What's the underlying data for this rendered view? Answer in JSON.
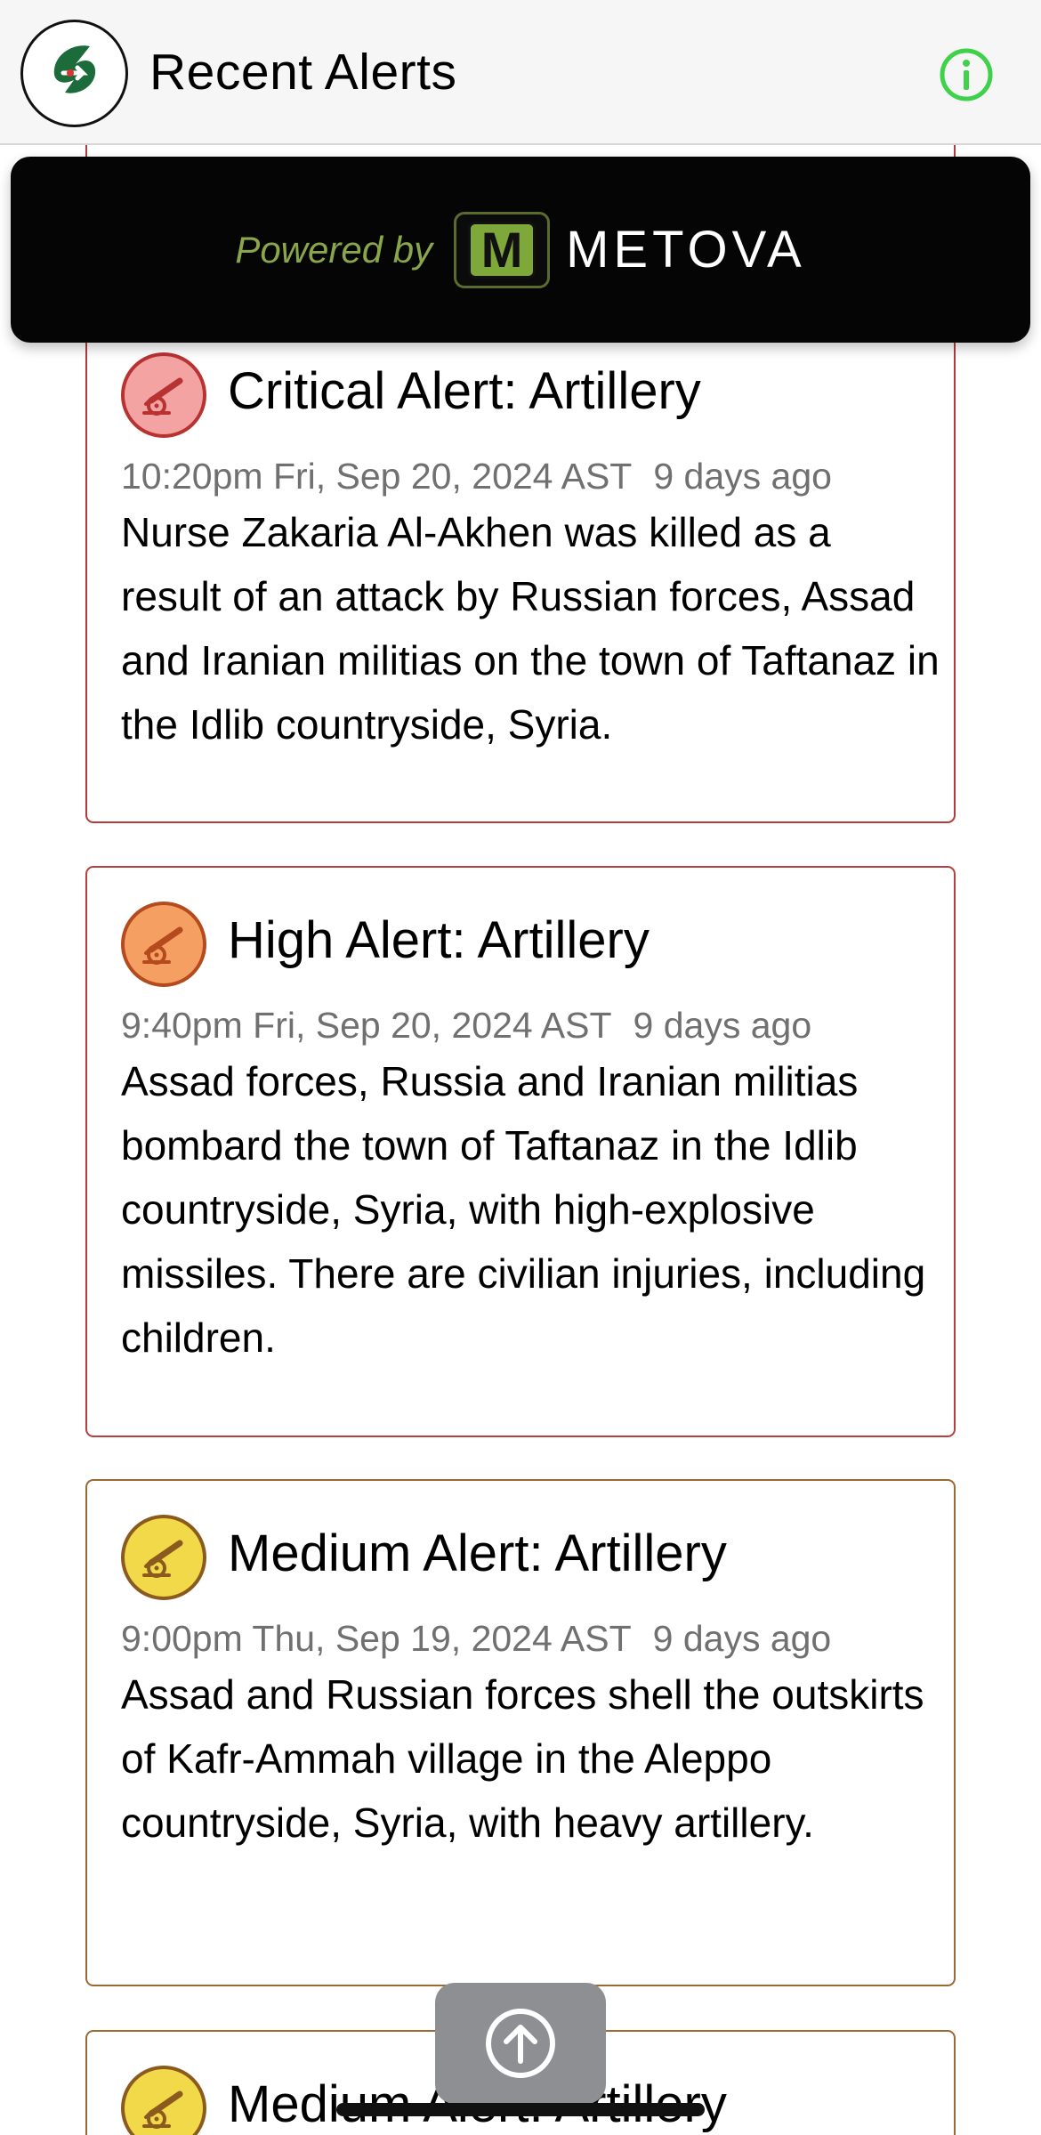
{
  "header": {
    "title": "Recent Alerts",
    "logo_icon": "app-logo-icon",
    "info_icon": "info-icon",
    "info_color": "#3fd14a"
  },
  "banner": {
    "powered_by": "Powered by",
    "brand_letter": "M",
    "brand_name": "METOVA"
  },
  "alerts": [
    {
      "title": "Critical Alert: Artillery",
      "time": "10:20pm Fri, Sep 20, 2024 AST",
      "ago": "9 days ago",
      "body": "Nurse Zakaria Al-Akhen was killed as a result of an attack by Russian forces, Assad and Iranian militias on the town of Taftanaz in the Idlib countryside, Syria.",
      "severity": "critical",
      "icon": "artillery-icon",
      "border_color": "#b23a3a",
      "icon_fill": "#f4a3a3",
      "icon_stroke": "#b83232"
    },
    {
      "title": "High Alert: Artillery",
      "time": "9:40pm Fri, Sep 20, 2024 AST",
      "ago": "9 days ago",
      "body": "Assad forces, Russia and Iranian militias bombard the town of Taftanaz in the Idlib countryside, Syria, with high-explosive missiles. There are civilian injuries, including children.",
      "severity": "high",
      "icon": "artillery-icon",
      "border_color": "#b64040",
      "icon_fill": "#f5a062",
      "icon_stroke": "#b44a1e"
    },
    {
      "title": "Medium Alert: Artillery",
      "time": "9:00pm Thu, Sep 19, 2024 AST",
      "ago": "9 days ago",
      "body": "Assad and Russian forces shell the outskirts of Kafr-Ammah village in the Aleppo countryside, Syria, with heavy artillery.",
      "severity": "medium",
      "icon": "artillery-icon",
      "border_color": "#9a6a35",
      "icon_fill": "#f2d94a",
      "icon_stroke": "#8a5a1e"
    },
    {
      "title": "Medium Alert: Artillery",
      "severity": "medium",
      "icon": "artillery-icon",
      "border_color": "#9a6a35",
      "icon_fill": "#f2d94a",
      "icon_stroke": "#8a5a1e"
    }
  ],
  "scroll_top": {
    "icon": "arrow-up-circle-icon"
  }
}
